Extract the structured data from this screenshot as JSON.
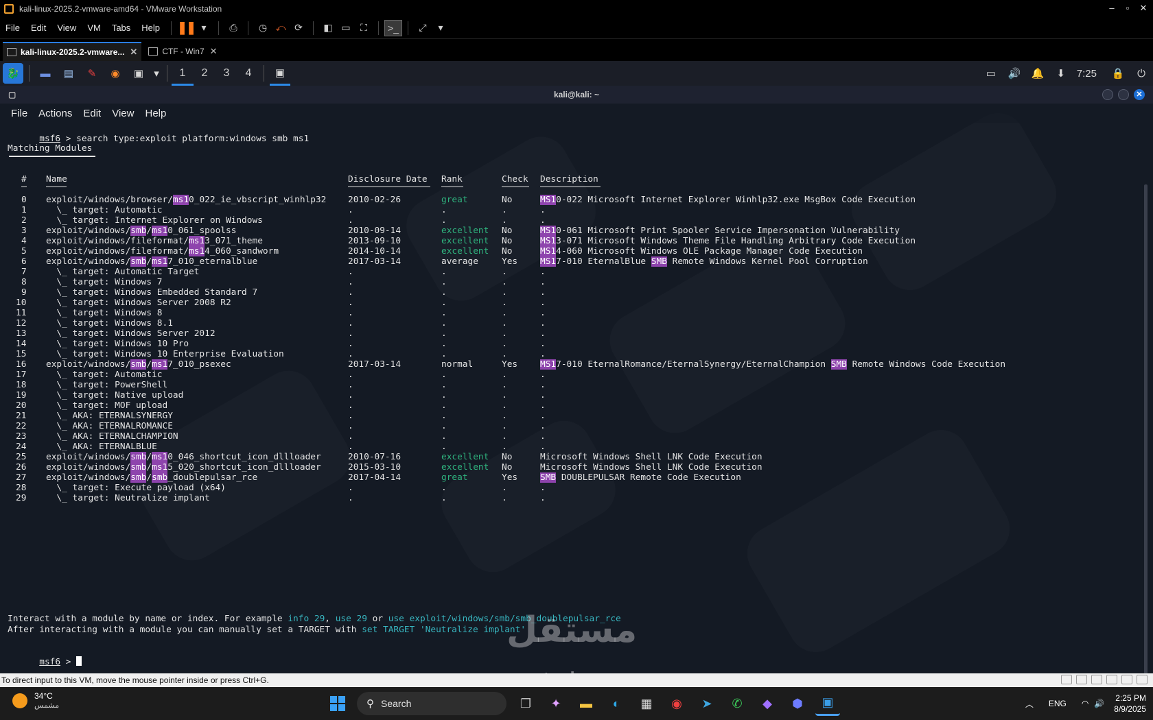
{
  "vmware": {
    "title": "kali-linux-2025.2-vmware-amd64 - VMware Workstation",
    "menu": [
      "File",
      "Edit",
      "View",
      "VM",
      "Tabs",
      "Help"
    ],
    "tabs": [
      {
        "label": "kali-linux-2025.2-vmware...",
        "selected": true
      },
      {
        "label": "CTF - Win7",
        "selected": false
      }
    ],
    "status_text": "To direct input to this VM, move the mouse pointer inside or press Ctrl+G."
  },
  "kali_panel": {
    "workspaces": [
      "1",
      "2",
      "3",
      "4"
    ],
    "time": "7:25"
  },
  "terminal": {
    "title": "kali@kali: ~",
    "menu": [
      "File",
      "Actions",
      "Edit",
      "View",
      "Help"
    ],
    "prompt": "msf6",
    "command": " > search type:exploit platform:windows smb ms1",
    "section_title": "Matching Modules",
    "headers": {
      "num": "#",
      "name": "Name",
      "date": "Disclosure Date",
      "rank": "Rank",
      "check": "Check",
      "desc": "Description"
    },
    "rows": [
      {
        "num": "0",
        "name": [
          [
            "exploit/windows/browser/",
            ""
          ],
          [
            "ms1",
            "hl"
          ],
          [
            "0_022_ie_vbscript_winhlp32",
            ""
          ]
        ],
        "date": "2010-02-26",
        "rank": "great",
        "rank_color": "green",
        "check": "No",
        "desc": [
          [
            "MS1",
            "hl"
          ],
          [
            "0-022 Microsoft Internet Explorer Winhlp32.exe MsgBox Code Execution",
            ""
          ]
        ]
      },
      {
        "num": "1",
        "name": [
          [
            "  \\_ target: Automatic",
            ""
          ]
        ],
        "date": ".",
        "rank": ".",
        "check": ".",
        "desc": [
          [
            ".",
            ""
          ]
        ]
      },
      {
        "num": "2",
        "name": [
          [
            "  \\_ target: Internet Explorer on Windows",
            ""
          ]
        ],
        "date": ".",
        "rank": ".",
        "check": ".",
        "desc": [
          [
            ".",
            ""
          ]
        ]
      },
      {
        "num": "3",
        "name": [
          [
            "exploit/windows/",
            ""
          ],
          [
            "smb",
            "hl"
          ],
          [
            "/",
            ""
          ],
          [
            "ms1",
            "hl"
          ],
          [
            "0_061_spoolss",
            ""
          ]
        ],
        "date": "2010-09-14",
        "rank": "excellent",
        "rank_color": "green",
        "check": "No",
        "desc": [
          [
            "MS1",
            "hl"
          ],
          [
            "0-061 Microsoft Print Spooler Service Impersonation Vulnerability",
            ""
          ]
        ]
      },
      {
        "num": "4",
        "name": [
          [
            "exploit/windows/fileformat/",
            ""
          ],
          [
            "ms1",
            "hl"
          ],
          [
            "3_071_theme",
            ""
          ]
        ],
        "date": "2013-09-10",
        "rank": "excellent",
        "rank_color": "green",
        "check": "No",
        "desc": [
          [
            "MS1",
            "hl"
          ],
          [
            "3-071 Microsoft Windows Theme File Handling Arbitrary Code Execution",
            ""
          ]
        ]
      },
      {
        "num": "5",
        "name": [
          [
            "exploit/windows/fileformat/",
            ""
          ],
          [
            "ms1",
            "hl"
          ],
          [
            "4_060_sandworm",
            ""
          ]
        ],
        "date": "2014-10-14",
        "rank": "excellent",
        "rank_color": "green",
        "check": "No",
        "desc": [
          [
            "MS1",
            "hl"
          ],
          [
            "4-060 Microsoft Windows OLE Package Manager Code Execution",
            ""
          ]
        ]
      },
      {
        "num": "6",
        "name": [
          [
            "exploit/windows/",
            ""
          ],
          [
            "smb",
            "hl"
          ],
          [
            "/",
            ""
          ],
          [
            "ms1",
            "hl"
          ],
          [
            "7_010_eternalblue",
            ""
          ]
        ],
        "date": "2017-03-14",
        "rank": "average",
        "rank_color": "",
        "check": "Yes",
        "desc": [
          [
            "MS1",
            "hl"
          ],
          [
            "7-010 EternalBlue ",
            ""
          ],
          [
            "SMB",
            "hl"
          ],
          [
            " Remote Windows Kernel Pool Corruption",
            ""
          ]
        ]
      },
      {
        "num": "7",
        "name": [
          [
            "  \\_ target: Automatic Target",
            ""
          ]
        ],
        "date": ".",
        "rank": ".",
        "check": ".",
        "desc": [
          [
            ".",
            ""
          ]
        ]
      },
      {
        "num": "8",
        "name": [
          [
            "  \\_ target: Windows 7",
            ""
          ]
        ],
        "date": ".",
        "rank": ".",
        "check": ".",
        "desc": [
          [
            ".",
            ""
          ]
        ]
      },
      {
        "num": "9",
        "name": [
          [
            "  \\_ target: Windows Embedded Standard 7",
            ""
          ]
        ],
        "date": ".",
        "rank": ".",
        "check": ".",
        "desc": [
          [
            ".",
            ""
          ]
        ]
      },
      {
        "num": "10",
        "name": [
          [
            "  \\_ target: Windows Server 2008 R2",
            ""
          ]
        ],
        "date": ".",
        "rank": ".",
        "check": ".",
        "desc": [
          [
            ".",
            ""
          ]
        ]
      },
      {
        "num": "11",
        "name": [
          [
            "  \\_ target: Windows 8",
            ""
          ]
        ],
        "date": ".",
        "rank": ".",
        "check": ".",
        "desc": [
          [
            ".",
            ""
          ]
        ]
      },
      {
        "num": "12",
        "name": [
          [
            "  \\_ target: Windows 8.1",
            ""
          ]
        ],
        "date": ".",
        "rank": ".",
        "check": ".",
        "desc": [
          [
            ".",
            ""
          ]
        ]
      },
      {
        "num": "13",
        "name": [
          [
            "  \\_ target: Windows Server 2012",
            ""
          ]
        ],
        "date": ".",
        "rank": ".",
        "check": ".",
        "desc": [
          [
            ".",
            ""
          ]
        ]
      },
      {
        "num": "14",
        "name": [
          [
            "  \\_ target: Windows 10 Pro",
            ""
          ]
        ],
        "date": ".",
        "rank": ".",
        "check": ".",
        "desc": [
          [
            ".",
            ""
          ]
        ]
      },
      {
        "num": "15",
        "name": [
          [
            "  \\_ target: Windows 10 Enterprise Evaluation",
            ""
          ]
        ],
        "date": ".",
        "rank": ".",
        "check": ".",
        "desc": [
          [
            ".",
            ""
          ]
        ]
      },
      {
        "num": "16",
        "name": [
          [
            "exploit/windows/",
            ""
          ],
          [
            "smb",
            "hl"
          ],
          [
            "/",
            ""
          ],
          [
            "ms1",
            "hl"
          ],
          [
            "7_010_psexec",
            ""
          ]
        ],
        "date": "2017-03-14",
        "rank": "normal",
        "rank_color": "",
        "check": "Yes",
        "desc": [
          [
            "MS1",
            "hl"
          ],
          [
            "7-010 EternalRomance/EternalSynergy/EternalChampion ",
            ""
          ],
          [
            "SMB",
            "hl"
          ],
          [
            " Remote Windows Code Execution",
            ""
          ]
        ]
      },
      {
        "num": "17",
        "name": [
          [
            "  \\_ target: Automatic",
            ""
          ]
        ],
        "date": ".",
        "rank": ".",
        "check": ".",
        "desc": [
          [
            ".",
            ""
          ]
        ]
      },
      {
        "num": "18",
        "name": [
          [
            "  \\_ target: PowerShell",
            ""
          ]
        ],
        "date": ".",
        "rank": ".",
        "check": ".",
        "desc": [
          [
            ".",
            ""
          ]
        ]
      },
      {
        "num": "19",
        "name": [
          [
            "  \\_ target: Native upload",
            ""
          ]
        ],
        "date": ".",
        "rank": ".",
        "check": ".",
        "desc": [
          [
            ".",
            ""
          ]
        ]
      },
      {
        "num": "20",
        "name": [
          [
            "  \\_ target: MOF upload",
            ""
          ]
        ],
        "date": ".",
        "rank": ".",
        "check": ".",
        "desc": [
          [
            ".",
            ""
          ]
        ]
      },
      {
        "num": "21",
        "name": [
          [
            "  \\_ AKA: ETERNALSYNERGY",
            ""
          ]
        ],
        "date": ".",
        "rank": ".",
        "check": ".",
        "desc": [
          [
            ".",
            ""
          ]
        ]
      },
      {
        "num": "22",
        "name": [
          [
            "  \\_ AKA: ETERNALROMANCE",
            ""
          ]
        ],
        "date": ".",
        "rank": ".",
        "check": ".",
        "desc": [
          [
            ".",
            ""
          ]
        ]
      },
      {
        "num": "23",
        "name": [
          [
            "  \\_ AKA: ETERNALCHAMPION",
            ""
          ]
        ],
        "date": ".",
        "rank": ".",
        "check": ".",
        "desc": [
          [
            ".",
            ""
          ]
        ]
      },
      {
        "num": "24",
        "name": [
          [
            "  \\_ AKA: ETERNALBLUE",
            ""
          ]
        ],
        "date": ".",
        "rank": ".",
        "check": ".",
        "desc": [
          [
            ".",
            ""
          ]
        ]
      },
      {
        "num": "25",
        "name": [
          [
            "exploit/windows/",
            ""
          ],
          [
            "smb",
            "hl"
          ],
          [
            "/",
            ""
          ],
          [
            "ms1",
            "hl"
          ],
          [
            "0_046_shortcut_icon_dllloader",
            ""
          ]
        ],
        "date": "2010-07-16",
        "rank": "excellent",
        "rank_color": "green",
        "check": "No",
        "desc": [
          [
            "Microsoft Windows Shell LNK Code Execution",
            ""
          ]
        ]
      },
      {
        "num": "26",
        "name": [
          [
            "exploit/windows/",
            ""
          ],
          [
            "smb",
            "hl"
          ],
          [
            "/",
            ""
          ],
          [
            "ms1",
            "hl"
          ],
          [
            "5_020_shortcut_icon_dllloader",
            ""
          ]
        ],
        "date": "2015-03-10",
        "rank": "excellent",
        "rank_color": "green",
        "check": "No",
        "desc": [
          [
            "Microsoft Windows Shell LNK Code Execution",
            ""
          ]
        ]
      },
      {
        "num": "27",
        "name": [
          [
            "exploit/windows/",
            ""
          ],
          [
            "smb",
            "hl"
          ],
          [
            "/",
            ""
          ],
          [
            "smb",
            "hl"
          ],
          [
            "_doublepulsar_rce",
            ""
          ]
        ],
        "date": "2017-04-14",
        "rank": "great",
        "rank_color": "green",
        "check": "Yes",
        "desc": [
          [
            "SMB",
            "hl"
          ],
          [
            " DOUBLEPULSAR Remote Code Execution",
            ""
          ]
        ]
      },
      {
        "num": "28",
        "name": [
          [
            "  \\_ target: Execute payload (x64)",
            ""
          ]
        ],
        "date": ".",
        "rank": ".",
        "check": ".",
        "desc": [
          [
            ".",
            ""
          ]
        ]
      },
      {
        "num": "29",
        "name": [
          [
            "  \\_ target: Neutralize implant",
            ""
          ]
        ],
        "date": ".",
        "rank": ".",
        "check": ".",
        "desc": [
          [
            ".",
            ""
          ]
        ]
      }
    ],
    "footer1": [
      [
        "Interact with a module by name or index. For example ",
        ""
      ],
      [
        "info 29",
        "cyan"
      ],
      [
        ", ",
        ""
      ],
      [
        "use 29",
        "cyan"
      ],
      [
        " or ",
        ""
      ],
      [
        "use exploit/windows/smb/smb_doublepulsar_rce",
        "cyan"
      ]
    ],
    "footer2": [
      [
        "After interacting with a module you can manually set a TARGET with ",
        ""
      ],
      [
        "set TARGET 'Neutralize implant'",
        "cyan"
      ]
    ],
    "final_prompt": "msf6",
    "final_prompt_suffix": " > "
  },
  "watermark": {
    "arabic": "مستقل",
    "latin": "mostaql.com"
  },
  "taskbar": {
    "temp": "34°C",
    "weather_desc": "مشمس",
    "search_label": "Search",
    "lang": "ENG",
    "time": "2:25 PM",
    "date": "8/9/2025"
  },
  "colors": {
    "highlight": "#8e44ad",
    "rank_green": "#2fb37e",
    "link_cyan": "#38b6c0",
    "workspace_accent": "#2c8ae8"
  }
}
